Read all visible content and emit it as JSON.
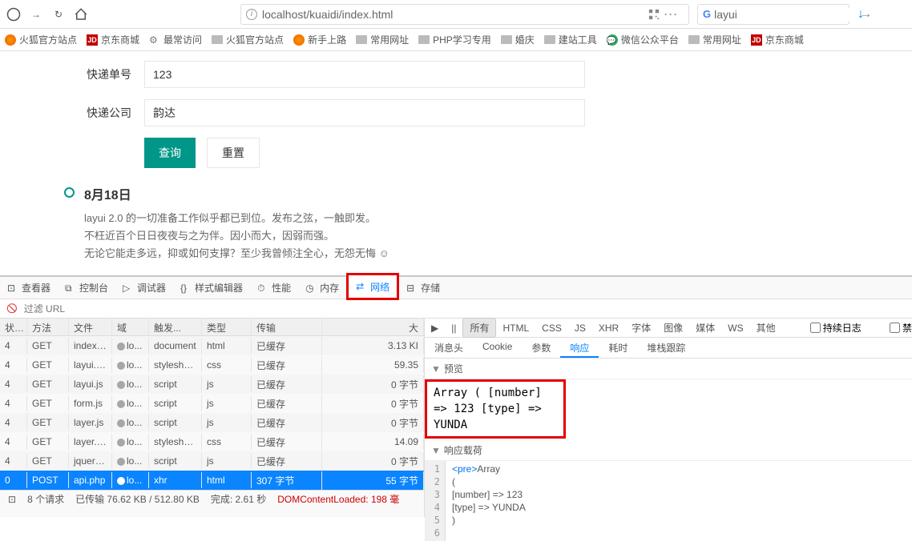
{
  "navbar": {
    "url": "localhost/kuaidi/index.html",
    "search": "layui"
  },
  "bookmarks": [
    {
      "icon": "fx",
      "label": "火狐官方站点"
    },
    {
      "icon": "jd",
      "label": "京东商城"
    },
    {
      "icon": "cog",
      "label": "最常访问"
    },
    {
      "icon": "folder",
      "label": "火狐官方站点"
    },
    {
      "icon": "fx",
      "label": "新手上路"
    },
    {
      "icon": "folder",
      "label": "常用网址"
    },
    {
      "icon": "folder",
      "label": "PHP学习专用"
    },
    {
      "icon": "folder",
      "label": "婚庆"
    },
    {
      "icon": "folder",
      "label": "建站工具"
    },
    {
      "icon": "wx",
      "label": "微信公众平台"
    },
    {
      "icon": "folder",
      "label": "常用网址"
    },
    {
      "icon": "jd",
      "label": "京东商城"
    }
  ],
  "form": {
    "express_no_label": "快递单号",
    "express_no_value": "123",
    "company_label": "快递公司",
    "company_value": "韵达",
    "submit": "查询",
    "reset": "重置"
  },
  "timeline": {
    "title": "8月18日",
    "line1": "layui 2.0 的一切准备工作似乎都已到位。发布之弦，一触即发。",
    "line2": "不枉近百个日日夜夜与之为伴。因小而大，因弱而强。",
    "line3": "无论它能走多远，抑或如何支撑？至少我曾倾注全心，无怨无悔 ☺"
  },
  "devtools": {
    "tabs": [
      "查看器",
      "控制台",
      "调试器",
      "样式编辑器",
      "性能",
      "内存",
      "网络",
      "存储"
    ],
    "filter_placeholder": "过滤 URL",
    "columns": {
      "status": "状态",
      "method": "方法",
      "file": "文件",
      "domain": "域",
      "cause": "触发...",
      "type": "类型",
      "transfer": "传输",
      "size": "大"
    },
    "rows": [
      {
        "status": "4",
        "method": "GET",
        "file": "index....",
        "domain": "lo...",
        "cause": "document",
        "type": "html",
        "transfer": "已缓存",
        "size": "3.13 KI"
      },
      {
        "status": "4",
        "method": "GET",
        "file": "layui.css",
        "domain": "lo...",
        "cause": "stylesheet",
        "type": "css",
        "transfer": "已缓存",
        "size": "59.35"
      },
      {
        "status": "4",
        "method": "GET",
        "file": "layui.js",
        "domain": "lo...",
        "cause": "script",
        "type": "js",
        "transfer": "已缓存",
        "size": "0 字节"
      },
      {
        "status": "4",
        "method": "GET",
        "file": "form.js",
        "domain": "lo...",
        "cause": "script",
        "type": "js",
        "transfer": "已缓存",
        "size": "0 字节"
      },
      {
        "status": "4",
        "method": "GET",
        "file": "layer.js",
        "domain": "lo...",
        "cause": "script",
        "type": "js",
        "transfer": "已缓存",
        "size": "0 字节"
      },
      {
        "status": "4",
        "method": "GET",
        "file": "layer.c...",
        "domain": "lo...",
        "cause": "stylesheet",
        "type": "css",
        "transfer": "已缓存",
        "size": "14.09"
      },
      {
        "status": "4",
        "method": "GET",
        "file": "jquery.js",
        "domain": "lo...",
        "cause": "script",
        "type": "js",
        "transfer": "已缓存",
        "size": "0 字节"
      },
      {
        "status": "0",
        "method": "POST",
        "file": "api.php",
        "domain": "lo...",
        "cause": "xhr",
        "type": "html",
        "transfer": "307 字节",
        "size": "55 字节",
        "selected": true
      }
    ],
    "right_top": {
      "play": "▶",
      "pause": "⏸",
      "all": "所有",
      "types": [
        "HTML",
        "CSS",
        "JS",
        "XHR",
        "字体",
        "图像",
        "媒体",
        "WS",
        "其他"
      ],
      "persist": "持续日志",
      "disable": "禁"
    },
    "detail_tabs": [
      "消息头",
      "Cookie",
      "参数",
      "响应",
      "耗时",
      "堆栈跟踪"
    ],
    "preview_label": "预览",
    "preview_lines": [
      "Array",
      "(",
      "    [number] => 123",
      "    [type] => YUNDA"
    ],
    "payload_label": "响应载荷",
    "payload_lines": [
      "<pre>Array",
      "(",
      "    [number] => 123",
      "    [type] => YUNDA",
      ")",
      ""
    ],
    "status_bar": {
      "requests": "8 个请求",
      "transferred": "已传输 76.62 KB / 512.80 KB",
      "finish": "完成: 2.61 秒",
      "dom": "DOMContentLoaded: 198 毫"
    }
  }
}
